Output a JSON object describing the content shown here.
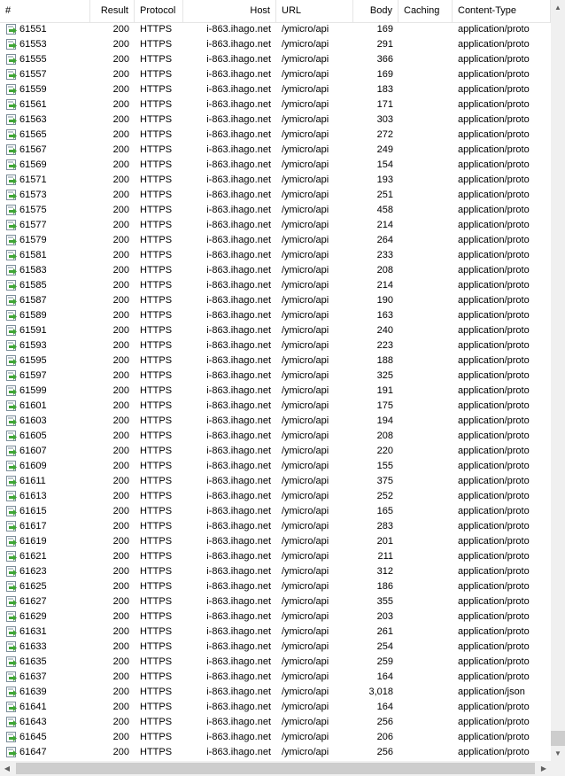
{
  "columns": {
    "num": "#",
    "result": "Result",
    "protocol": "Protocol",
    "host": "Host",
    "url": "URL",
    "body": "Body",
    "caching": "Caching",
    "content_type": "Content-Type"
  },
  "rows": [
    {
      "num": "61551",
      "result": "200",
      "protocol": "HTTPS",
      "host": "i-863.ihago.net",
      "url": "/ymicro/api",
      "body": "169",
      "caching": "",
      "content_type": "application/proto"
    },
    {
      "num": "61553",
      "result": "200",
      "protocol": "HTTPS",
      "host": "i-863.ihago.net",
      "url": "/ymicro/api",
      "body": "291",
      "caching": "",
      "content_type": "application/proto"
    },
    {
      "num": "61555",
      "result": "200",
      "protocol": "HTTPS",
      "host": "i-863.ihago.net",
      "url": "/ymicro/api",
      "body": "366",
      "caching": "",
      "content_type": "application/proto"
    },
    {
      "num": "61557",
      "result": "200",
      "protocol": "HTTPS",
      "host": "i-863.ihago.net",
      "url": "/ymicro/api",
      "body": "169",
      "caching": "",
      "content_type": "application/proto"
    },
    {
      "num": "61559",
      "result": "200",
      "protocol": "HTTPS",
      "host": "i-863.ihago.net",
      "url": "/ymicro/api",
      "body": "183",
      "caching": "",
      "content_type": "application/proto"
    },
    {
      "num": "61561",
      "result": "200",
      "protocol": "HTTPS",
      "host": "i-863.ihago.net",
      "url": "/ymicro/api",
      "body": "171",
      "caching": "",
      "content_type": "application/proto"
    },
    {
      "num": "61563",
      "result": "200",
      "protocol": "HTTPS",
      "host": "i-863.ihago.net",
      "url": "/ymicro/api",
      "body": "303",
      "caching": "",
      "content_type": "application/proto"
    },
    {
      "num": "61565",
      "result": "200",
      "protocol": "HTTPS",
      "host": "i-863.ihago.net",
      "url": "/ymicro/api",
      "body": "272",
      "caching": "",
      "content_type": "application/proto"
    },
    {
      "num": "61567",
      "result": "200",
      "protocol": "HTTPS",
      "host": "i-863.ihago.net",
      "url": "/ymicro/api",
      "body": "249",
      "caching": "",
      "content_type": "application/proto"
    },
    {
      "num": "61569",
      "result": "200",
      "protocol": "HTTPS",
      "host": "i-863.ihago.net",
      "url": "/ymicro/api",
      "body": "154",
      "caching": "",
      "content_type": "application/proto"
    },
    {
      "num": "61571",
      "result": "200",
      "protocol": "HTTPS",
      "host": "i-863.ihago.net",
      "url": "/ymicro/api",
      "body": "193",
      "caching": "",
      "content_type": "application/proto"
    },
    {
      "num": "61573",
      "result": "200",
      "protocol": "HTTPS",
      "host": "i-863.ihago.net",
      "url": "/ymicro/api",
      "body": "251",
      "caching": "",
      "content_type": "application/proto"
    },
    {
      "num": "61575",
      "result": "200",
      "protocol": "HTTPS",
      "host": "i-863.ihago.net",
      "url": "/ymicro/api",
      "body": "458",
      "caching": "",
      "content_type": "application/proto"
    },
    {
      "num": "61577",
      "result": "200",
      "protocol": "HTTPS",
      "host": "i-863.ihago.net",
      "url": "/ymicro/api",
      "body": "214",
      "caching": "",
      "content_type": "application/proto"
    },
    {
      "num": "61579",
      "result": "200",
      "protocol": "HTTPS",
      "host": "i-863.ihago.net",
      "url": "/ymicro/api",
      "body": "264",
      "caching": "",
      "content_type": "application/proto"
    },
    {
      "num": "61581",
      "result": "200",
      "protocol": "HTTPS",
      "host": "i-863.ihago.net",
      "url": "/ymicro/api",
      "body": "233",
      "caching": "",
      "content_type": "application/proto"
    },
    {
      "num": "61583",
      "result": "200",
      "protocol": "HTTPS",
      "host": "i-863.ihago.net",
      "url": "/ymicro/api",
      "body": "208",
      "caching": "",
      "content_type": "application/proto"
    },
    {
      "num": "61585",
      "result": "200",
      "protocol": "HTTPS",
      "host": "i-863.ihago.net",
      "url": "/ymicro/api",
      "body": "214",
      "caching": "",
      "content_type": "application/proto"
    },
    {
      "num": "61587",
      "result": "200",
      "protocol": "HTTPS",
      "host": "i-863.ihago.net",
      "url": "/ymicro/api",
      "body": "190",
      "caching": "",
      "content_type": "application/proto"
    },
    {
      "num": "61589",
      "result": "200",
      "protocol": "HTTPS",
      "host": "i-863.ihago.net",
      "url": "/ymicro/api",
      "body": "163",
      "caching": "",
      "content_type": "application/proto"
    },
    {
      "num": "61591",
      "result": "200",
      "protocol": "HTTPS",
      "host": "i-863.ihago.net",
      "url": "/ymicro/api",
      "body": "240",
      "caching": "",
      "content_type": "application/proto"
    },
    {
      "num": "61593",
      "result": "200",
      "protocol": "HTTPS",
      "host": "i-863.ihago.net",
      "url": "/ymicro/api",
      "body": "223",
      "caching": "",
      "content_type": "application/proto"
    },
    {
      "num": "61595",
      "result": "200",
      "protocol": "HTTPS",
      "host": "i-863.ihago.net",
      "url": "/ymicro/api",
      "body": "188",
      "caching": "",
      "content_type": "application/proto"
    },
    {
      "num": "61597",
      "result": "200",
      "protocol": "HTTPS",
      "host": "i-863.ihago.net",
      "url": "/ymicro/api",
      "body": "325",
      "caching": "",
      "content_type": "application/proto"
    },
    {
      "num": "61599",
      "result": "200",
      "protocol": "HTTPS",
      "host": "i-863.ihago.net",
      "url": "/ymicro/api",
      "body": "191",
      "caching": "",
      "content_type": "application/proto"
    },
    {
      "num": "61601",
      "result": "200",
      "protocol": "HTTPS",
      "host": "i-863.ihago.net",
      "url": "/ymicro/api",
      "body": "175",
      "caching": "",
      "content_type": "application/proto"
    },
    {
      "num": "61603",
      "result": "200",
      "protocol": "HTTPS",
      "host": "i-863.ihago.net",
      "url": "/ymicro/api",
      "body": "194",
      "caching": "",
      "content_type": "application/proto"
    },
    {
      "num": "61605",
      "result": "200",
      "protocol": "HTTPS",
      "host": "i-863.ihago.net",
      "url": "/ymicro/api",
      "body": "208",
      "caching": "",
      "content_type": "application/proto"
    },
    {
      "num": "61607",
      "result": "200",
      "protocol": "HTTPS",
      "host": "i-863.ihago.net",
      "url": "/ymicro/api",
      "body": "220",
      "caching": "",
      "content_type": "application/proto"
    },
    {
      "num": "61609",
      "result": "200",
      "protocol": "HTTPS",
      "host": "i-863.ihago.net",
      "url": "/ymicro/api",
      "body": "155",
      "caching": "",
      "content_type": "application/proto"
    },
    {
      "num": "61611",
      "result": "200",
      "protocol": "HTTPS",
      "host": "i-863.ihago.net",
      "url": "/ymicro/api",
      "body": "375",
      "caching": "",
      "content_type": "application/proto"
    },
    {
      "num": "61613",
      "result": "200",
      "protocol": "HTTPS",
      "host": "i-863.ihago.net",
      "url": "/ymicro/api",
      "body": "252",
      "caching": "",
      "content_type": "application/proto"
    },
    {
      "num": "61615",
      "result": "200",
      "protocol": "HTTPS",
      "host": "i-863.ihago.net",
      "url": "/ymicro/api",
      "body": "165",
      "caching": "",
      "content_type": "application/proto"
    },
    {
      "num": "61617",
      "result": "200",
      "protocol": "HTTPS",
      "host": "i-863.ihago.net",
      "url": "/ymicro/api",
      "body": "283",
      "caching": "",
      "content_type": "application/proto"
    },
    {
      "num": "61619",
      "result": "200",
      "protocol": "HTTPS",
      "host": "i-863.ihago.net",
      "url": "/ymicro/api",
      "body": "201",
      "caching": "",
      "content_type": "application/proto"
    },
    {
      "num": "61621",
      "result": "200",
      "protocol": "HTTPS",
      "host": "i-863.ihago.net",
      "url": "/ymicro/api",
      "body": "211",
      "caching": "",
      "content_type": "application/proto"
    },
    {
      "num": "61623",
      "result": "200",
      "protocol": "HTTPS",
      "host": "i-863.ihago.net",
      "url": "/ymicro/api",
      "body": "312",
      "caching": "",
      "content_type": "application/proto"
    },
    {
      "num": "61625",
      "result": "200",
      "protocol": "HTTPS",
      "host": "i-863.ihago.net",
      "url": "/ymicro/api",
      "body": "186",
      "caching": "",
      "content_type": "application/proto"
    },
    {
      "num": "61627",
      "result": "200",
      "protocol": "HTTPS",
      "host": "i-863.ihago.net",
      "url": "/ymicro/api",
      "body": "355",
      "caching": "",
      "content_type": "application/proto"
    },
    {
      "num": "61629",
      "result": "200",
      "protocol": "HTTPS",
      "host": "i-863.ihago.net",
      "url": "/ymicro/api",
      "body": "203",
      "caching": "",
      "content_type": "application/proto"
    },
    {
      "num": "61631",
      "result": "200",
      "protocol": "HTTPS",
      "host": "i-863.ihago.net",
      "url": "/ymicro/api",
      "body": "261",
      "caching": "",
      "content_type": "application/proto"
    },
    {
      "num": "61633",
      "result": "200",
      "protocol": "HTTPS",
      "host": "i-863.ihago.net",
      "url": "/ymicro/api",
      "body": "254",
      "caching": "",
      "content_type": "application/proto"
    },
    {
      "num": "61635",
      "result": "200",
      "protocol": "HTTPS",
      "host": "i-863.ihago.net",
      "url": "/ymicro/api",
      "body": "259",
      "caching": "",
      "content_type": "application/proto"
    },
    {
      "num": "61637",
      "result": "200",
      "protocol": "HTTPS",
      "host": "i-863.ihago.net",
      "url": "/ymicro/api",
      "body": "164",
      "caching": "",
      "content_type": "application/proto"
    },
    {
      "num": "61639",
      "result": "200",
      "protocol": "HTTPS",
      "host": "i-863.ihago.net",
      "url": "/ymicro/api",
      "body": "3,018",
      "caching": "",
      "content_type": "application/json"
    },
    {
      "num": "61641",
      "result": "200",
      "protocol": "HTTPS",
      "host": "i-863.ihago.net",
      "url": "/ymicro/api",
      "body": "164",
      "caching": "",
      "content_type": "application/proto"
    },
    {
      "num": "61643",
      "result": "200",
      "protocol": "HTTPS",
      "host": "i-863.ihago.net",
      "url": "/ymicro/api",
      "body": "256",
      "caching": "",
      "content_type": "application/proto"
    },
    {
      "num": "61645",
      "result": "200",
      "protocol": "HTTPS",
      "host": "i-863.ihago.net",
      "url": "/ymicro/api",
      "body": "206",
      "caching": "",
      "content_type": "application/proto"
    },
    {
      "num": "61647",
      "result": "200",
      "protocol": "HTTPS",
      "host": "i-863.ihago.net",
      "url": "/ymicro/api",
      "body": "256",
      "caching": "",
      "content_type": "application/proto"
    }
  ],
  "icons": {
    "row_icon": "session-arrow-icon"
  },
  "colors": {
    "icon_green": "#3fa535",
    "icon_frame": "#7a8c99"
  }
}
